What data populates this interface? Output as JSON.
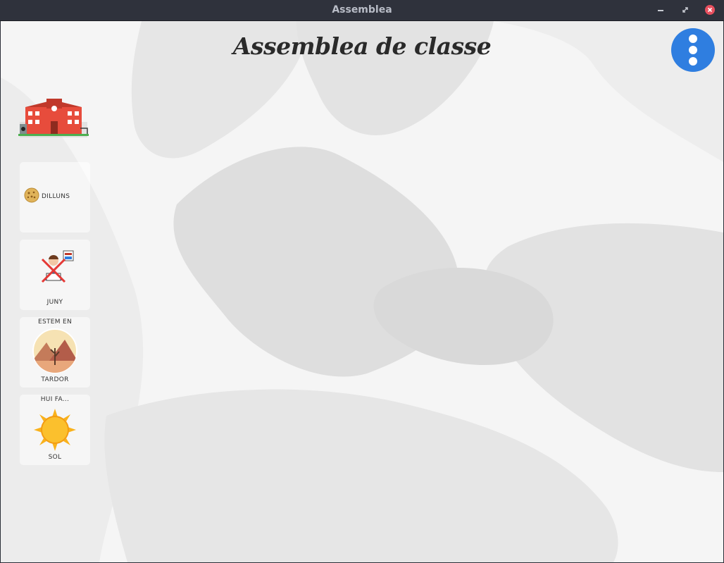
{
  "window": {
    "title": "Assemblea",
    "buttons": [
      "minimize-icon",
      "maximize-icon",
      "close-icon"
    ]
  },
  "app": {
    "title": "Assemblea de classe",
    "menu_icon": "more-vertical-icon",
    "accent": "#2f7ee0"
  },
  "cards": [
    {
      "id": "day",
      "icon": "cookie-icon",
      "label": "DILLUNS"
    },
    {
      "id": "month",
      "icon": "student-reading-crossed-icon",
      "label": "JUNY"
    },
    {
      "id": "season",
      "header": "ESTEM EN",
      "icon": "autumn-landscape-icon",
      "label": "TARDOR"
    },
    {
      "id": "weather",
      "header": "HUI FA...",
      "icon": "sun-icon",
      "label": "SOL"
    }
  ]
}
